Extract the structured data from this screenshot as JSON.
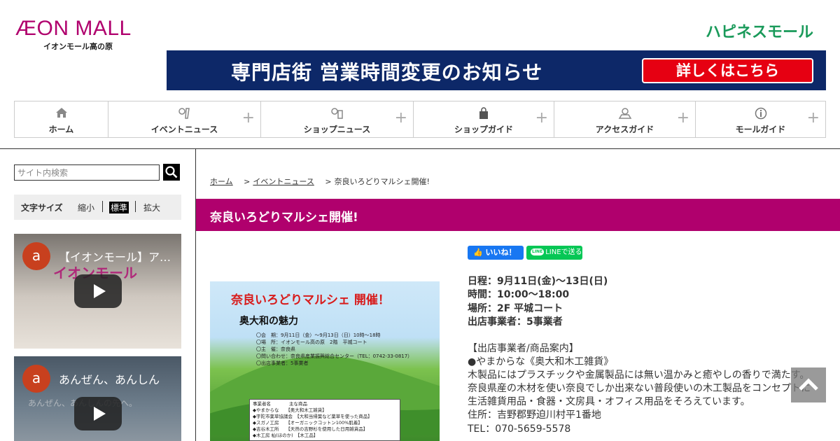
{
  "header": {
    "logo_main": "ÆON MALL",
    "logo_sub": "イオンモール高の原",
    "happiness_logo": "ハピネスモール",
    "banner_text": "専門店街 営業時間変更のお知らせ",
    "banner_button": "詳しくはこちら"
  },
  "nav": {
    "items": [
      {
        "label": "ホーム",
        "icon": "home-icon",
        "glyph": "⌂"
      },
      {
        "label": "イベントニュース",
        "icon": "event-icon",
        "glyph": "♪"
      },
      {
        "label": "ショップニュース",
        "icon": "shop-news-icon",
        "glyph": "ⓘ"
      },
      {
        "label": "ショップガイド",
        "icon": "shopping-bag-icon",
        "glyph": "■"
      },
      {
        "label": "アクセスガイド",
        "icon": "map-pin-icon",
        "glyph": "⚲"
      },
      {
        "label": "モールガイド",
        "icon": "info-icon",
        "glyph": "ⓘ"
      }
    ],
    "plus": "+"
  },
  "sidebar": {
    "search_placeholder": "サイト内検索",
    "fontsize_label": "文字サイズ",
    "fontsize_small": "縮小",
    "fontsize_normal": "標準",
    "fontsize_large": "拡大",
    "video1_title": "【イオンモール】アプリ",
    "video1_deco": "イオンモール",
    "video2_title": "あんぜん、あんしん",
    "video2_deco": "あんぜん、あんしんの先へ。",
    "channel_initial": "a"
  },
  "breadcrumb": {
    "home": "ホーム",
    "event": "イベントニュース",
    "current": "奈良いろどりマルシェ開催!",
    "sep": ">"
  },
  "article": {
    "title": "奈良いろどりマルシェ開催!",
    "like_label": "いいね！",
    "line_label": "LINEで送る",
    "line_logo": "LINE",
    "info": [
      "日程：9月11日(金)～13日(日)",
      "時間：10:00～18:00",
      "場所：2F 平城コート",
      "出店事業者：5事業者"
    ],
    "body": [
      "【出店事業者/商品案内】",
      "●やまからな《奥大和木工雑貨》",
      "木製品にはプラスチックや金属製品には無い温かみと癒やしの香りで満たす。",
      "奈良県産の木材を使い奈良でしか出来ない普段使いの木工製品をコンセプトに生活雑貨用品・食器・文房具・オフィス用品をそろえています。",
      "住所：吉野郡野迫川村平1番地",
      "TEL：070-5659-5578"
    ]
  },
  "flyer": {
    "title": "奈良いろどりマルシェ 開催！",
    "subtitle": "奥大和の魅力",
    "lines": [
      "〇会　期：9月11日（金）～9月13日（日）10時～18時",
      "〇場　所：イオンモール高の原　2階　平城コート",
      "〇主　催：奈良県",
      "〇問い合わせ：奈良県産業振興総合センター（TEL：0742-33-0817）",
      "〇出店事業者：5事業者"
    ],
    "table": [
      "事業者名　　　　主な商品",
      "◆やまからな　　【奥大和木工雑貨】",
      "◆宇陀市薬草協議会　【大和当帰葉など薬草を使った商品】",
      "◆スガノ工房　　【オーガニックコットン100%肌着】",
      "◆吉谷木工所　　【天然の吉野杉を使用した日用雑貨品】",
      "◆木工房 杣(ほのか)　【木工品】"
    ]
  }
}
